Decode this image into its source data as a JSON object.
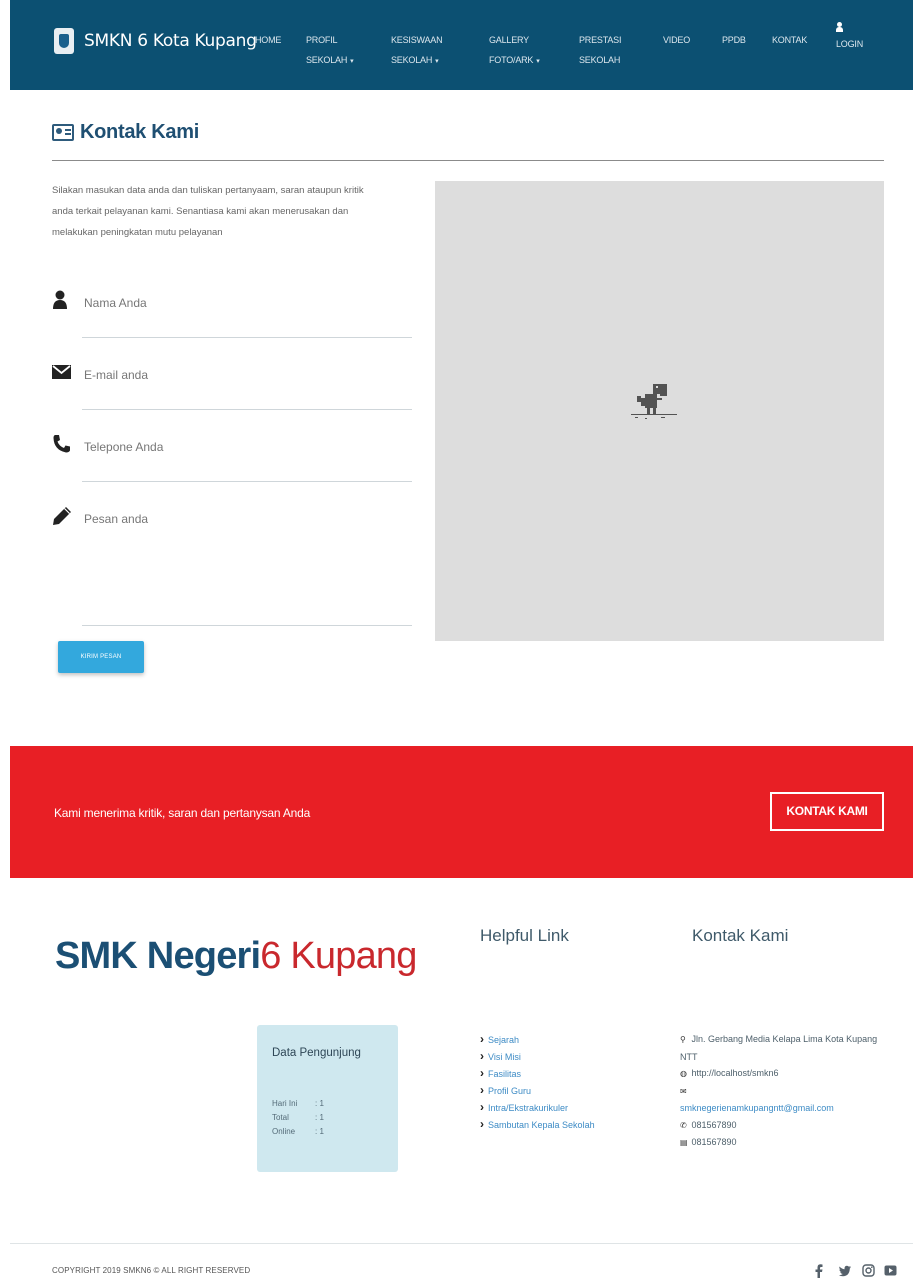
{
  "brand": {
    "title": "SMKN 6 Kota Kupang"
  },
  "nav": {
    "home": "HOME",
    "profil_l1": "PROFIL",
    "profil_l2": "SEKOLAH",
    "kesiswaan_l1": "KESISWAAN",
    "kesiswaan_l2": "SEKOLAH",
    "gallery_l1": "GALLERY",
    "gallery_l2": "FOTO/ARK",
    "prestasi_l1": "PRESTASI",
    "prestasi_l2": "SEKOLAH",
    "video": "VIDEO",
    "ppdb": "PPDB",
    "kontak": "KONTAK",
    "login": "LOGIN"
  },
  "contact": {
    "title": "Kontak Kami",
    "intro": "Silakan masukan data anda dan tuliskan pertanyaam, saran ataupun kritik anda terkait pelayanan kami. Senantiasa kami akan menerusakan dan melakukan peningkatan mutu pelayanan",
    "name_label": "Nama Anda",
    "email_label": "E-mail anda",
    "phone_label": "Telepone Anda",
    "message_label": "Pesan anda",
    "send_label": "KIRIM PESAN"
  },
  "cta": {
    "text": "Kami menerima kritik, saran dan pertanysan Anda",
    "button": "KONTAK KAMI"
  },
  "footer": {
    "brand_strong": "SMK Negeri",
    "brand_light": "6 Kupang",
    "visitors": {
      "title": "Data Pengunjung",
      "rows": [
        {
          "label": "Hari Ini",
          "value": ": 1"
        },
        {
          "label": "Total",
          "value": ": 1"
        },
        {
          "label": "Online",
          "value": ": 1"
        }
      ]
    },
    "helpful_title": "Helpful Link",
    "links": [
      "Sejarah",
      "Visi Misi",
      "Fasilitas",
      "Profil Guru",
      "Intra/Ekstrakurikuler",
      "Sambutan Kepala Sekolah"
    ],
    "contact_title": "Kontak Kami",
    "address": "Jln. Gerbang Media Kelapa Lima Kota Kupang NTT",
    "website": "http://localhost/smkn6",
    "email": "smknegerienamkupangntt@gmail.com",
    "phone": "081567890",
    "fax": "081567890",
    "copyright": "COPYRIGHT 2019 SMKN6 © ALL RIGHT RESERVED"
  }
}
